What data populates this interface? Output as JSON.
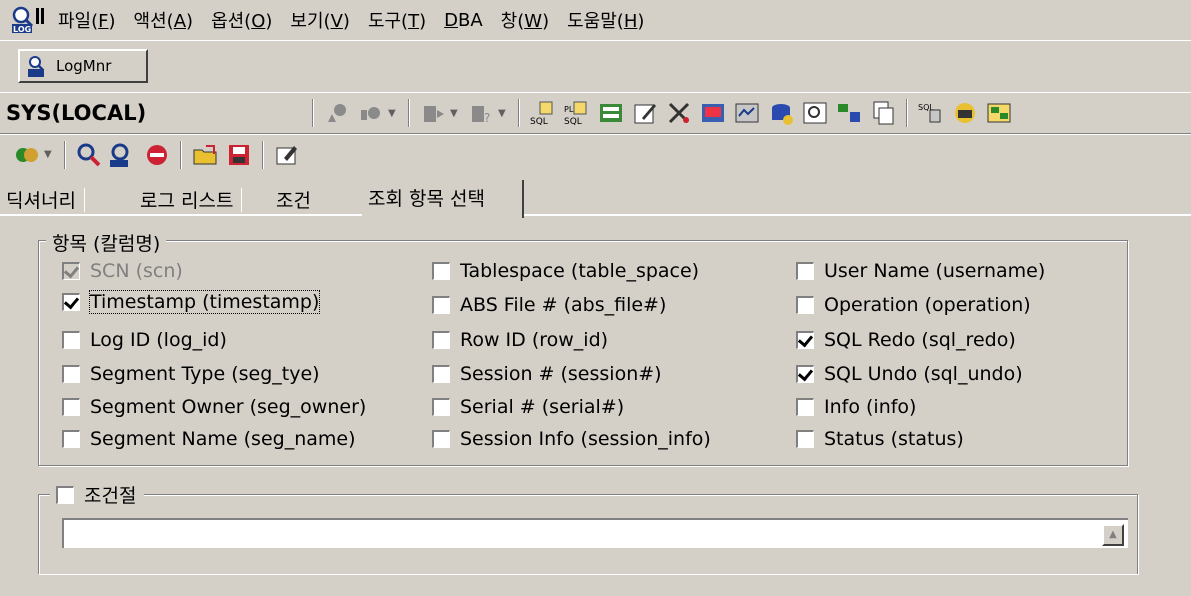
{
  "menubar": {
    "items": [
      {
        "label": "파일(",
        "key": "F",
        "tail": ")"
      },
      {
        "label": "액션(",
        "key": "A",
        "tail": ")"
      },
      {
        "label": "옵션(",
        "key": "O",
        "tail": ")"
      },
      {
        "label": "보기(",
        "key": "V",
        "tail": ")"
      },
      {
        "label": "도구(",
        "key": "T",
        "tail": ")"
      },
      {
        "label": "",
        "key": "D",
        "tail": "BA"
      },
      {
        "label": "창(",
        "key": "W",
        "tail": ")"
      },
      {
        "label": "도움말(",
        "key": "H",
        "tail": ")"
      }
    ]
  },
  "doc_tab": {
    "label": "LogMnr"
  },
  "toolbar": {
    "connection": "SYS(LOCAL)"
  },
  "tabs": {
    "dictionary": "딕셔너리",
    "log_list": "로그 리스트",
    "condition": "조건",
    "select_columns": "조회 항목 선택"
  },
  "columns_group": {
    "title": "항목 (칼럼명)",
    "items": [
      {
        "label": "SCN (scn)",
        "checked": true,
        "disabled": true
      },
      {
        "label": "Timestamp (timestamp)",
        "checked": true,
        "disabled": false
      },
      {
        "label": "Log ID (log_id)",
        "checked": false,
        "disabled": false
      },
      {
        "label": "Segment Type (seg_tye)",
        "checked": false,
        "disabled": false
      },
      {
        "label": "Segment Owner (seg_owner)",
        "checked": false,
        "disabled": false
      },
      {
        "label": "Segment Name (seg_name)",
        "checked": false,
        "disabled": false
      },
      {
        "label": "Tablespace (table_space)",
        "checked": false,
        "disabled": false
      },
      {
        "label": "ABS File # (abs_file#)",
        "checked": false,
        "disabled": false
      },
      {
        "label": "Row ID (row_id)",
        "checked": false,
        "disabled": false
      },
      {
        "label": "Session # (session#)",
        "checked": false,
        "disabled": false
      },
      {
        "label": "Serial # (serial#)",
        "checked": false,
        "disabled": false
      },
      {
        "label": "Session Info (session_info)",
        "checked": false,
        "disabled": false
      },
      {
        "label": "User Name (username)",
        "checked": false,
        "disabled": false
      },
      {
        "label": "Operation (operation)",
        "checked": false,
        "disabled": false
      },
      {
        "label": "SQL Redo (sql_redo)",
        "checked": true,
        "disabled": false
      },
      {
        "label": "SQL Undo (sql_undo)",
        "checked": true,
        "disabled": false
      },
      {
        "label": "Info (info)",
        "checked": false,
        "disabled": false
      },
      {
        "label": "Status (status)",
        "checked": false,
        "disabled": false
      }
    ]
  },
  "where_group": {
    "title": "조건절",
    "checked": false
  },
  "colors": {
    "window_bg": "#d4d0c8",
    "shadow": "#808080",
    "highlight": "#ffffff"
  }
}
